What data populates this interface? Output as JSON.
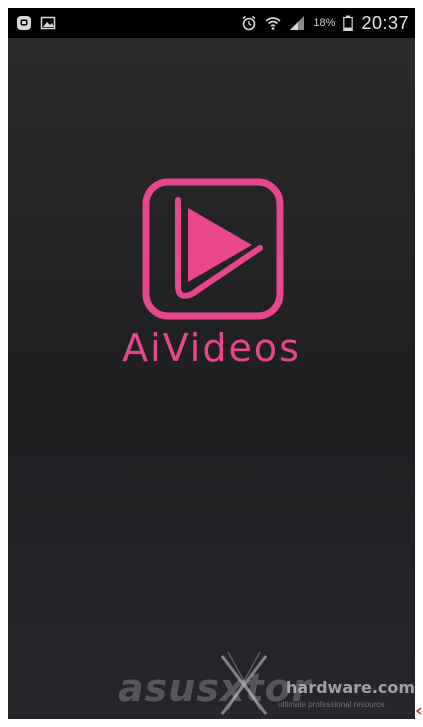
{
  "status_bar": {
    "battery_percent": "18%",
    "time": "20:37",
    "left_icons": [
      "notification-app-icon",
      "image-icon"
    ],
    "right_icons": [
      "alarm-icon",
      "wifi-icon",
      "signal-icon",
      "battery-icon"
    ]
  },
  "splash": {
    "app_name": "AiVideos",
    "logo_icon": "play-icon",
    "accent_color": "#e8468f"
  },
  "watermark": {
    "brand": "asusxtor",
    "site": "hardware.com",
    "tagline": "ultimate professional resource"
  }
}
